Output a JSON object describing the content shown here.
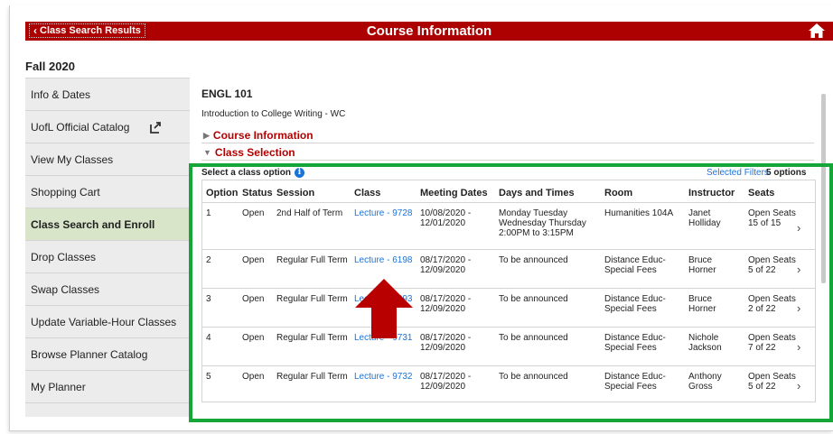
{
  "topbar": {
    "back_label": "Class Search Results",
    "title": "Course Information",
    "bar_color": "#ad0000",
    "more_label": ":"
  },
  "term": "Fall 2020",
  "sidebar": {
    "items": [
      {
        "label": "Info & Dates",
        "active": false
      },
      {
        "label": "UofL Official Catalog",
        "active": false,
        "icon": "external-link-icon"
      },
      {
        "label": "View My Classes",
        "active": false
      },
      {
        "label": "Shopping Cart",
        "active": false
      },
      {
        "label": "Class Search and Enroll",
        "active": true
      },
      {
        "label": "Drop Classes",
        "active": false
      },
      {
        "label": "Swap Classes",
        "active": false
      },
      {
        "label": "Update Variable-Hour Classes",
        "active": false
      },
      {
        "label": "Browse Planner Catalog",
        "active": false
      },
      {
        "label": "My Planner",
        "active": false
      }
    ],
    "active_color": "#d8e5c9"
  },
  "course": {
    "code": "ENGL 101",
    "name": "Introduction to College Writing - WC",
    "info_link": "Course Information",
    "selection_link": "Class Selection"
  },
  "selection": {
    "label": "Select a class option",
    "filters_link": "Selected Filters",
    "count": "5 options"
  },
  "table": {
    "headers": [
      "Option",
      "Status",
      "Session",
      "Class",
      "Meeting Dates",
      "Days and Times",
      "Room",
      "Instructor",
      "Seats"
    ],
    "rows": [
      {
        "option": "1",
        "status": "Open",
        "session": "2nd Half of Term",
        "class": "Lecture - 9728",
        "dates": [
          "10/08/2020 -",
          "12/01/2020"
        ],
        "days": [
          "Monday Tuesday",
          "Wednesday Thursday",
          "2:00PM to 3:15PM"
        ],
        "room": [
          "Humanities 104A"
        ],
        "instructor": [
          "Janet",
          "Holliday"
        ],
        "seats": [
          "Open Seats",
          "15 of 15"
        ]
      },
      {
        "option": "2",
        "status": "Open",
        "session": "Regular Full Term",
        "class": "Lecture - 6198",
        "dates": [
          "08/17/2020 -",
          "12/09/2020"
        ],
        "days": [
          "To be announced"
        ],
        "room": [
          "Distance Educ-",
          "Special Fees"
        ],
        "instructor": [
          "Bruce",
          "Horner"
        ],
        "seats": [
          "Open Seats",
          "5 of 22"
        ]
      },
      {
        "option": "3",
        "status": "Open",
        "session": "Regular Full Term",
        "class": "Lecture - 6393",
        "dates": [
          "08/17/2020 -",
          "12/09/2020"
        ],
        "days": [
          "To be announced"
        ],
        "room": [
          "Distance Educ-",
          "Special Fees"
        ],
        "instructor": [
          "Bruce",
          "Horner"
        ],
        "seats": [
          "Open Seats",
          "2 of 22"
        ]
      },
      {
        "option": "4",
        "status": "Open",
        "session": "Regular Full Term",
        "class": "Lecture - 9731",
        "dates": [
          "08/17/2020 -",
          "12/09/2020"
        ],
        "days": [
          "To be announced"
        ],
        "room": [
          "Distance Educ-",
          "Special Fees"
        ],
        "instructor": [
          "Nichole",
          "Jackson"
        ],
        "seats": [
          "Open Seats",
          "7 of 22"
        ]
      },
      {
        "option": "5",
        "status": "Open",
        "session": "Regular Full Term",
        "class": "Lecture - 9732",
        "dates": [
          "08/17/2020 -",
          "12/09/2020"
        ],
        "days": [
          "To be announced"
        ],
        "room": [
          "Distance Educ-",
          "Special Fees"
        ],
        "instructor": [
          "Anthony",
          "Gross"
        ],
        "seats": [
          "Open Seats",
          "5 of 22"
        ]
      }
    ]
  },
  "annotations": {
    "highlight_color": "#16a538",
    "arrow_color": "#b80000"
  }
}
